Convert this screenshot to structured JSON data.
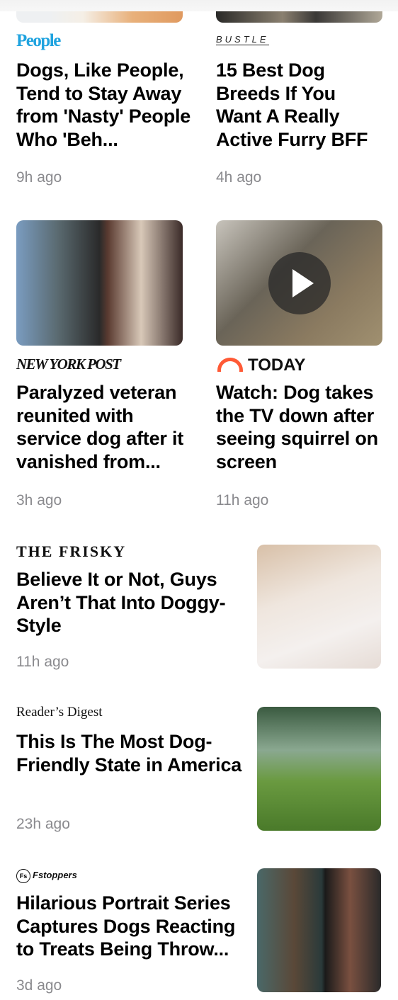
{
  "grid_articles": [
    {
      "source": "People",
      "title": "Dogs, Like People, Tend to Stay Away from 'Nasty' People Who 'Beh...",
      "time": "9h ago"
    },
    {
      "source": "BUSTLE",
      "title": "15 Best Dog Breeds If You Want A Really Active Furry BFF",
      "time": "4h ago"
    },
    {
      "source": "NEW YORK POST",
      "title": "Paralyzed veteran reunited with service dog after it vanished from...",
      "time": "3h ago"
    },
    {
      "source": "TODAY",
      "title": "Watch: Dog takes the TV down after seeing squirrel on screen",
      "time": "11h ago",
      "video": true
    }
  ],
  "list_articles": [
    {
      "source": "THE FRISKY",
      "title": "Believe It or Not, Guys Aren’t That Into Doggy-Style",
      "time": "11h ago"
    },
    {
      "source": "Reader’s Digest",
      "title": "This Is The Most Dog-Friendly State in America",
      "time": "23h ago"
    },
    {
      "source": "Fstoppers",
      "title": "Hilarious Portrait Series Captures Dogs Reacting to Treats Being Throw...",
      "time": "3d ago"
    }
  ],
  "colors": {
    "people": "#1fa3df",
    "today": "#ff5a36",
    "time": "#8a8a8e"
  }
}
